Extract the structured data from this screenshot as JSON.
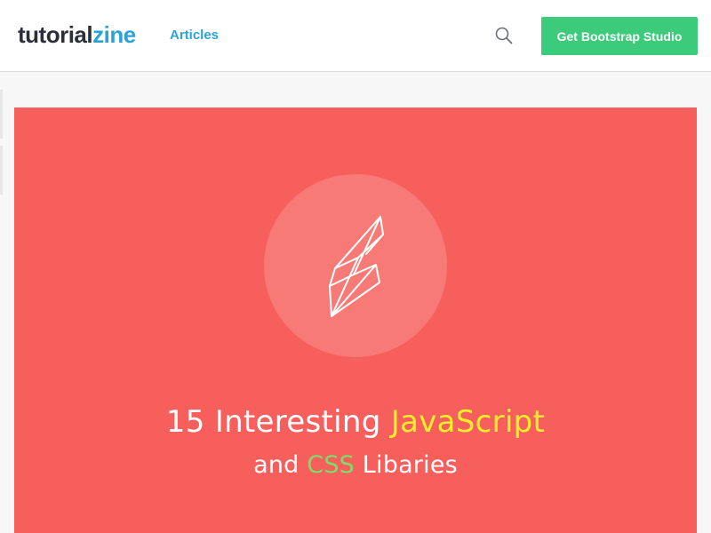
{
  "header": {
    "logo_part1": "tutorial",
    "logo_part2": "zine",
    "nav_articles": "Articles",
    "search_icon": "search-icon",
    "cta_label": "Get Bootstrap Studio"
  },
  "hero": {
    "icon": "lightning-bolt-icon",
    "title_prefix": "15 Interesting ",
    "title_highlight": "JavaScript",
    "subtitle_prefix": "and ",
    "subtitle_highlight": "CSS",
    "subtitle_suffix": " Libaries"
  },
  "colors": {
    "logo_dark": "#2a2f3a",
    "accent_blue": "#2ba3d9",
    "cta_green": "#3bcb7a",
    "hero_red": "#f75f5c",
    "highlight_yellow": "#f2ee2a",
    "highlight_green": "#7fdc6a"
  }
}
